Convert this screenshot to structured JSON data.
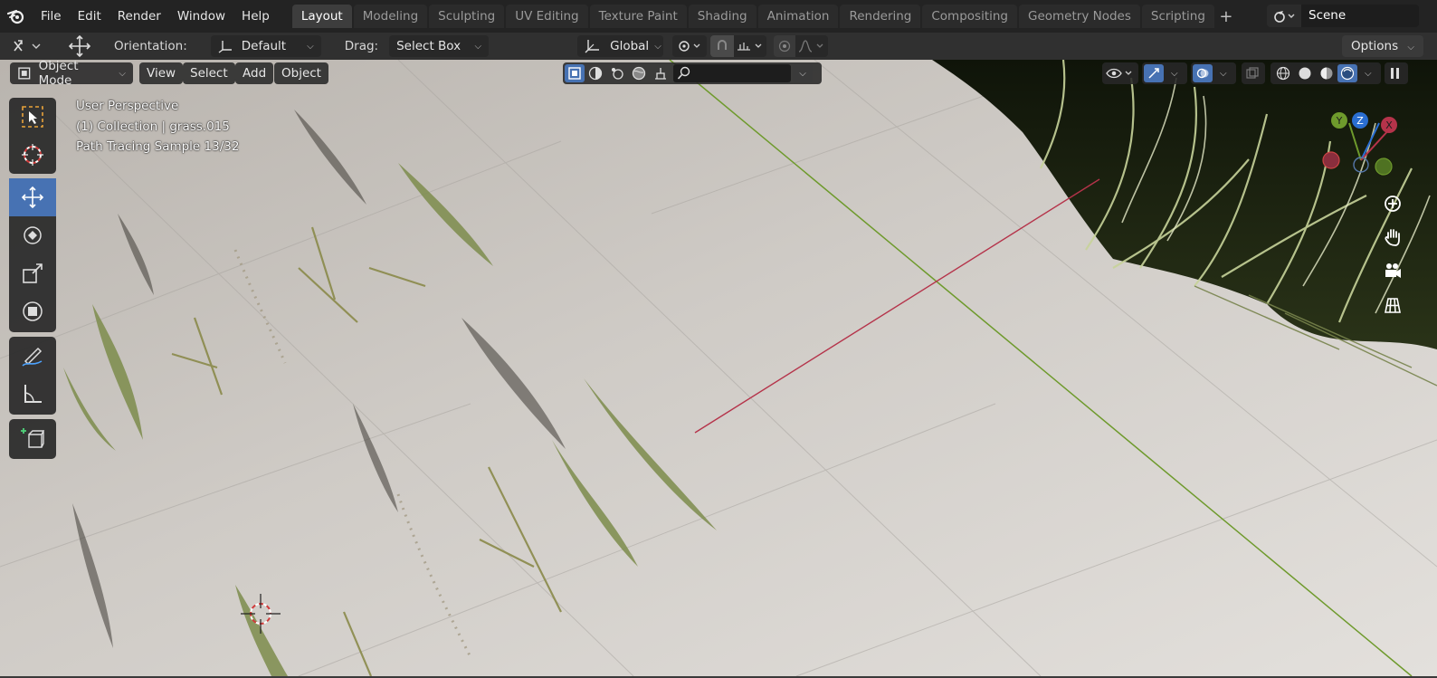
{
  "topbar": {
    "menus": [
      "File",
      "Edit",
      "Render",
      "Window",
      "Help"
    ],
    "tabs": [
      "Layout",
      "Modeling",
      "Sculpting",
      "UV Editing",
      "Texture Paint",
      "Shading",
      "Animation",
      "Rendering",
      "Compositing",
      "Geometry Nodes",
      "Scripting"
    ],
    "active_tab": "Layout",
    "scene_name": "Scene",
    "icons": {
      "app": "blender-logo-icon",
      "add_tab": "plus-icon",
      "scene": "scene-icon"
    }
  },
  "toolbar": {
    "orientation_label": "Orientation:",
    "orientation_value": "Default",
    "drag_label": "Drag:",
    "drag_value": "Select Box",
    "transform_orientation": "Global",
    "options_label": "Options"
  },
  "viewport": {
    "mode": "Object Mode",
    "menus": [
      "View",
      "Select",
      "Add",
      "Object"
    ],
    "overlay_lines": [
      "User Perspective",
      "(1) Collection | grass.015",
      "Path Tracing Sample 13/32"
    ],
    "gizmo_axes": {
      "x": "X",
      "y": "Y",
      "z": "Z"
    },
    "colors": {
      "x_axis": "#b5334a",
      "y_axis": "#6e9a2c",
      "z_axis": "#2a6ed1",
      "active_tool": "#4772b3"
    }
  }
}
